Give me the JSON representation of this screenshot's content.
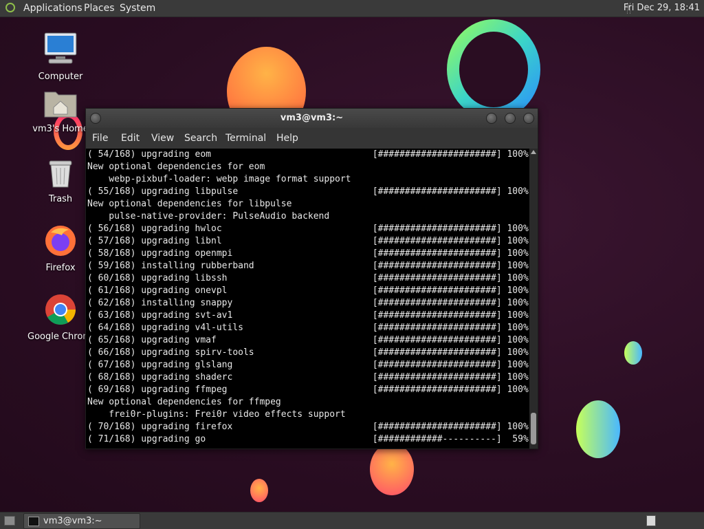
{
  "top_panel": {
    "menus": [
      "Applications",
      "Places",
      "System"
    ],
    "clock": "Fri Dec 29, 18:41"
  },
  "desktop_icons": [
    {
      "label": "Computer",
      "icon": "computer-icon"
    },
    {
      "label": "vm3's Home",
      "icon": "home-folder-icon"
    },
    {
      "label": "Trash",
      "icon": "trash-icon"
    },
    {
      "label": "Firefox",
      "icon": "firefox-icon"
    },
    {
      "label": "Google Chrome",
      "icon": "chrome-icon"
    }
  ],
  "window": {
    "title": "vm3@vm3:~",
    "menu": [
      "File",
      "Edit",
      "View",
      "Search",
      "Terminal",
      "Help"
    ]
  },
  "terminal_lines": [
    "( 54/168) upgrading eom                              [######################] 100%",
    "New optional dependencies for eom",
    "    webp-pixbuf-loader: webp image format support",
    "( 55/168) upgrading libpulse                         [######################] 100%",
    "New optional dependencies for libpulse",
    "    pulse-native-provider: PulseAudio backend",
    "( 56/168) upgrading hwloc                            [######################] 100%",
    "( 57/168) upgrading libnl                            [######################] 100%",
    "( 58/168) upgrading openmpi                          [######################] 100%",
    "( 59/168) installing rubberband                      [######################] 100%",
    "( 60/168) upgrading libssh                           [######################] 100%",
    "( 61/168) upgrading onevpl                           [######################] 100%",
    "( 62/168) installing snappy                          [######################] 100%",
    "( 63/168) upgrading svt-av1                          [######################] 100%",
    "( 64/168) upgrading v4l-utils                        [######################] 100%",
    "( 65/168) upgrading vmaf                             [######################] 100%",
    "( 66/168) upgrading spirv-tools                      [######################] 100%",
    "( 67/168) upgrading glslang                          [######################] 100%",
    "( 68/168) upgrading shaderc                          [######################] 100%",
    "( 69/168) upgrading ffmpeg                           [######################] 100%",
    "New optional dependencies for ffmpeg",
    "    frei0r-plugins: Frei0r video effects support",
    "( 70/168) upgrading firefox                          [######################] 100%",
    "( 71/168) upgrading go                               [############----------]  59%"
  ],
  "taskbar": {
    "task_label": "vm3@vm3:~"
  }
}
